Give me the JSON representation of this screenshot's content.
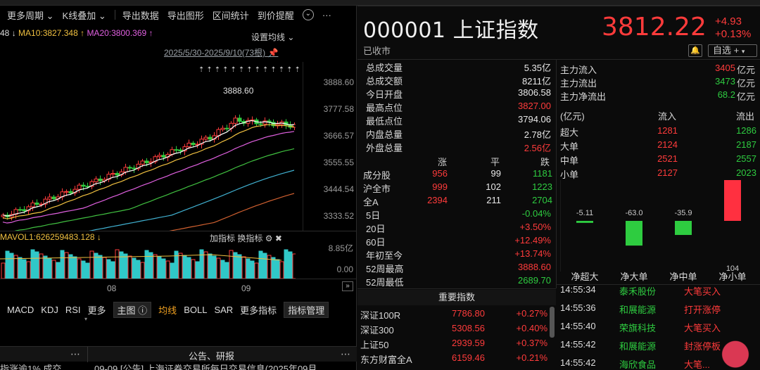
{
  "toolbar": {
    "period": "更多周期",
    "overlay": "K线叠加",
    "export_data": "导出数据",
    "export_chart": "导出图形",
    "range_stats": "区间统计",
    "alert": "到价提醒"
  },
  "ma": {
    "ma5_partial": "48",
    "ma10": "MA10:3827.348",
    "ma20": "MA20:3800.369",
    "settings": "设置均线"
  },
  "date_range": "2025/5/30-2025/9/10(73根)",
  "price_axis": [
    "3888.60",
    "3777.58",
    "3666.57",
    "3555.55",
    "3444.54",
    "3333.52"
  ],
  "peak_label": "3888.60",
  "volume": {
    "label": "MAVOL1:626259483.128",
    "add_indicator": "加指标",
    "switch_indicator": "换指标",
    "axis": [
      "8.85亿",
      "0.00"
    ]
  },
  "x_ticks": [
    "08",
    "09"
  ],
  "indicator_tabs": [
    "MACD",
    "KDJ",
    "RSI",
    "更多",
    "主图",
    "均线",
    "BOLL",
    "SAR",
    "更多指标",
    "指标管理"
  ],
  "news": {
    "header": "公告、研报",
    "left_snip": "指涨逾1% 成交...",
    "item": "09-09 [公告] 上海证券交易所每日交易信息(2025年09月..."
  },
  "quote": {
    "code": "000001",
    "name": "上证指数",
    "price": "3812.22",
    "change": "+4.93",
    "change_pct": "+0.13%",
    "status": "已收市",
    "bell": "🔔",
    "watchlist": "自选 +"
  },
  "stats": [
    {
      "k": "总成交量",
      "v": "5.35亿",
      "c": "white"
    },
    {
      "k": "总成交额",
      "v": "8211亿",
      "c": "white"
    },
    {
      "k": "今日开盘",
      "v": "3806.58",
      "c": "white"
    },
    {
      "k": "最高点位",
      "v": "3827.00",
      "c": "red"
    },
    {
      "k": "最低点位",
      "v": "3794.06",
      "c": "white"
    },
    {
      "k": "内盘总量",
      "v": "2.78亿",
      "c": "white"
    },
    {
      "k": "外盘总量",
      "v": "2.56亿",
      "c": "red"
    }
  ],
  "breadth": {
    "headers": [
      "涨",
      "平",
      "跌"
    ],
    "rows": [
      {
        "k": "成分股",
        "up": "956",
        "flat": "99",
        "down": "1181"
      },
      {
        "k": "沪全市",
        "up": "999",
        "flat": "102",
        "down": "1223"
      },
      {
        "k": "全A",
        "up": "2394",
        "flat": "211",
        "down": "2704"
      }
    ]
  },
  "performance": [
    {
      "k": "5日",
      "v": "-0.04%",
      "c": "green"
    },
    {
      "k": "20日",
      "v": "+3.50%",
      "c": "red"
    },
    {
      "k": "60日",
      "v": "+12.49%",
      "c": "red"
    },
    {
      "k": "年初至今",
      "v": "+13.74%",
      "c": "red"
    },
    {
      "k": "52周最高",
      "v": "3888.60",
      "c": "red"
    },
    {
      "k": "52周最低",
      "v": "2689.70",
      "c": "green"
    }
  ],
  "indices": {
    "header": "重要指数",
    "rows": [
      {
        "name": "深证100R",
        "price": "7786.80",
        "pct": "+0.27%"
      },
      {
        "name": "深证300",
        "price": "5308.56",
        "pct": "+0.40%"
      },
      {
        "name": "上证50",
        "price": "2939.59",
        "pct": "+0.37%"
      },
      {
        "name": "东方财富全A",
        "price": "6159.46",
        "pct": "+0.21%"
      }
    ]
  },
  "flows": {
    "main_in": {
      "k": "主力流入",
      "v": "3405",
      "u": "亿元"
    },
    "main_out": {
      "k": "主力流出",
      "v": "3473",
      "u": "亿元"
    },
    "main_net": {
      "k": "主力净流出",
      "v": "68.2",
      "u": "亿元"
    },
    "unit": "(亿元)",
    "col_in": "流入",
    "col_out": "流出",
    "rows": [
      {
        "k": "超大",
        "in": "1281",
        "out": "1286"
      },
      {
        "k": "大单",
        "in": "2124",
        "out": "2187"
      },
      {
        "k": "中单",
        "in": "2521",
        "out": "2557"
      },
      {
        "k": "小单",
        "in": "2127",
        "out": "2023"
      }
    ]
  },
  "chart_data": {
    "type": "bar",
    "categories": [
      "净超大",
      "净大单",
      "净中单",
      "净小单"
    ],
    "values": [
      -5.11,
      -63.0,
      -35.9,
      104
    ],
    "value_labels": [
      "-5.11",
      "-63.0",
      "-35.9",
      "104"
    ]
  },
  "ticks": [
    {
      "time": "14:55:34",
      "name": "泰禾股份",
      "event": "大笔买入"
    },
    {
      "time": "14:55:36",
      "name": "和展能源",
      "event": "打开涨停"
    },
    {
      "time": "14:55:40",
      "name": "荣旗科技",
      "event": "大笔买入"
    },
    {
      "time": "14:55:42",
      "name": "和展能源",
      "event": "封涨停板"
    },
    {
      "time": "14:55:42",
      "name": "海欣食品",
      "event": "大笔..."
    }
  ]
}
